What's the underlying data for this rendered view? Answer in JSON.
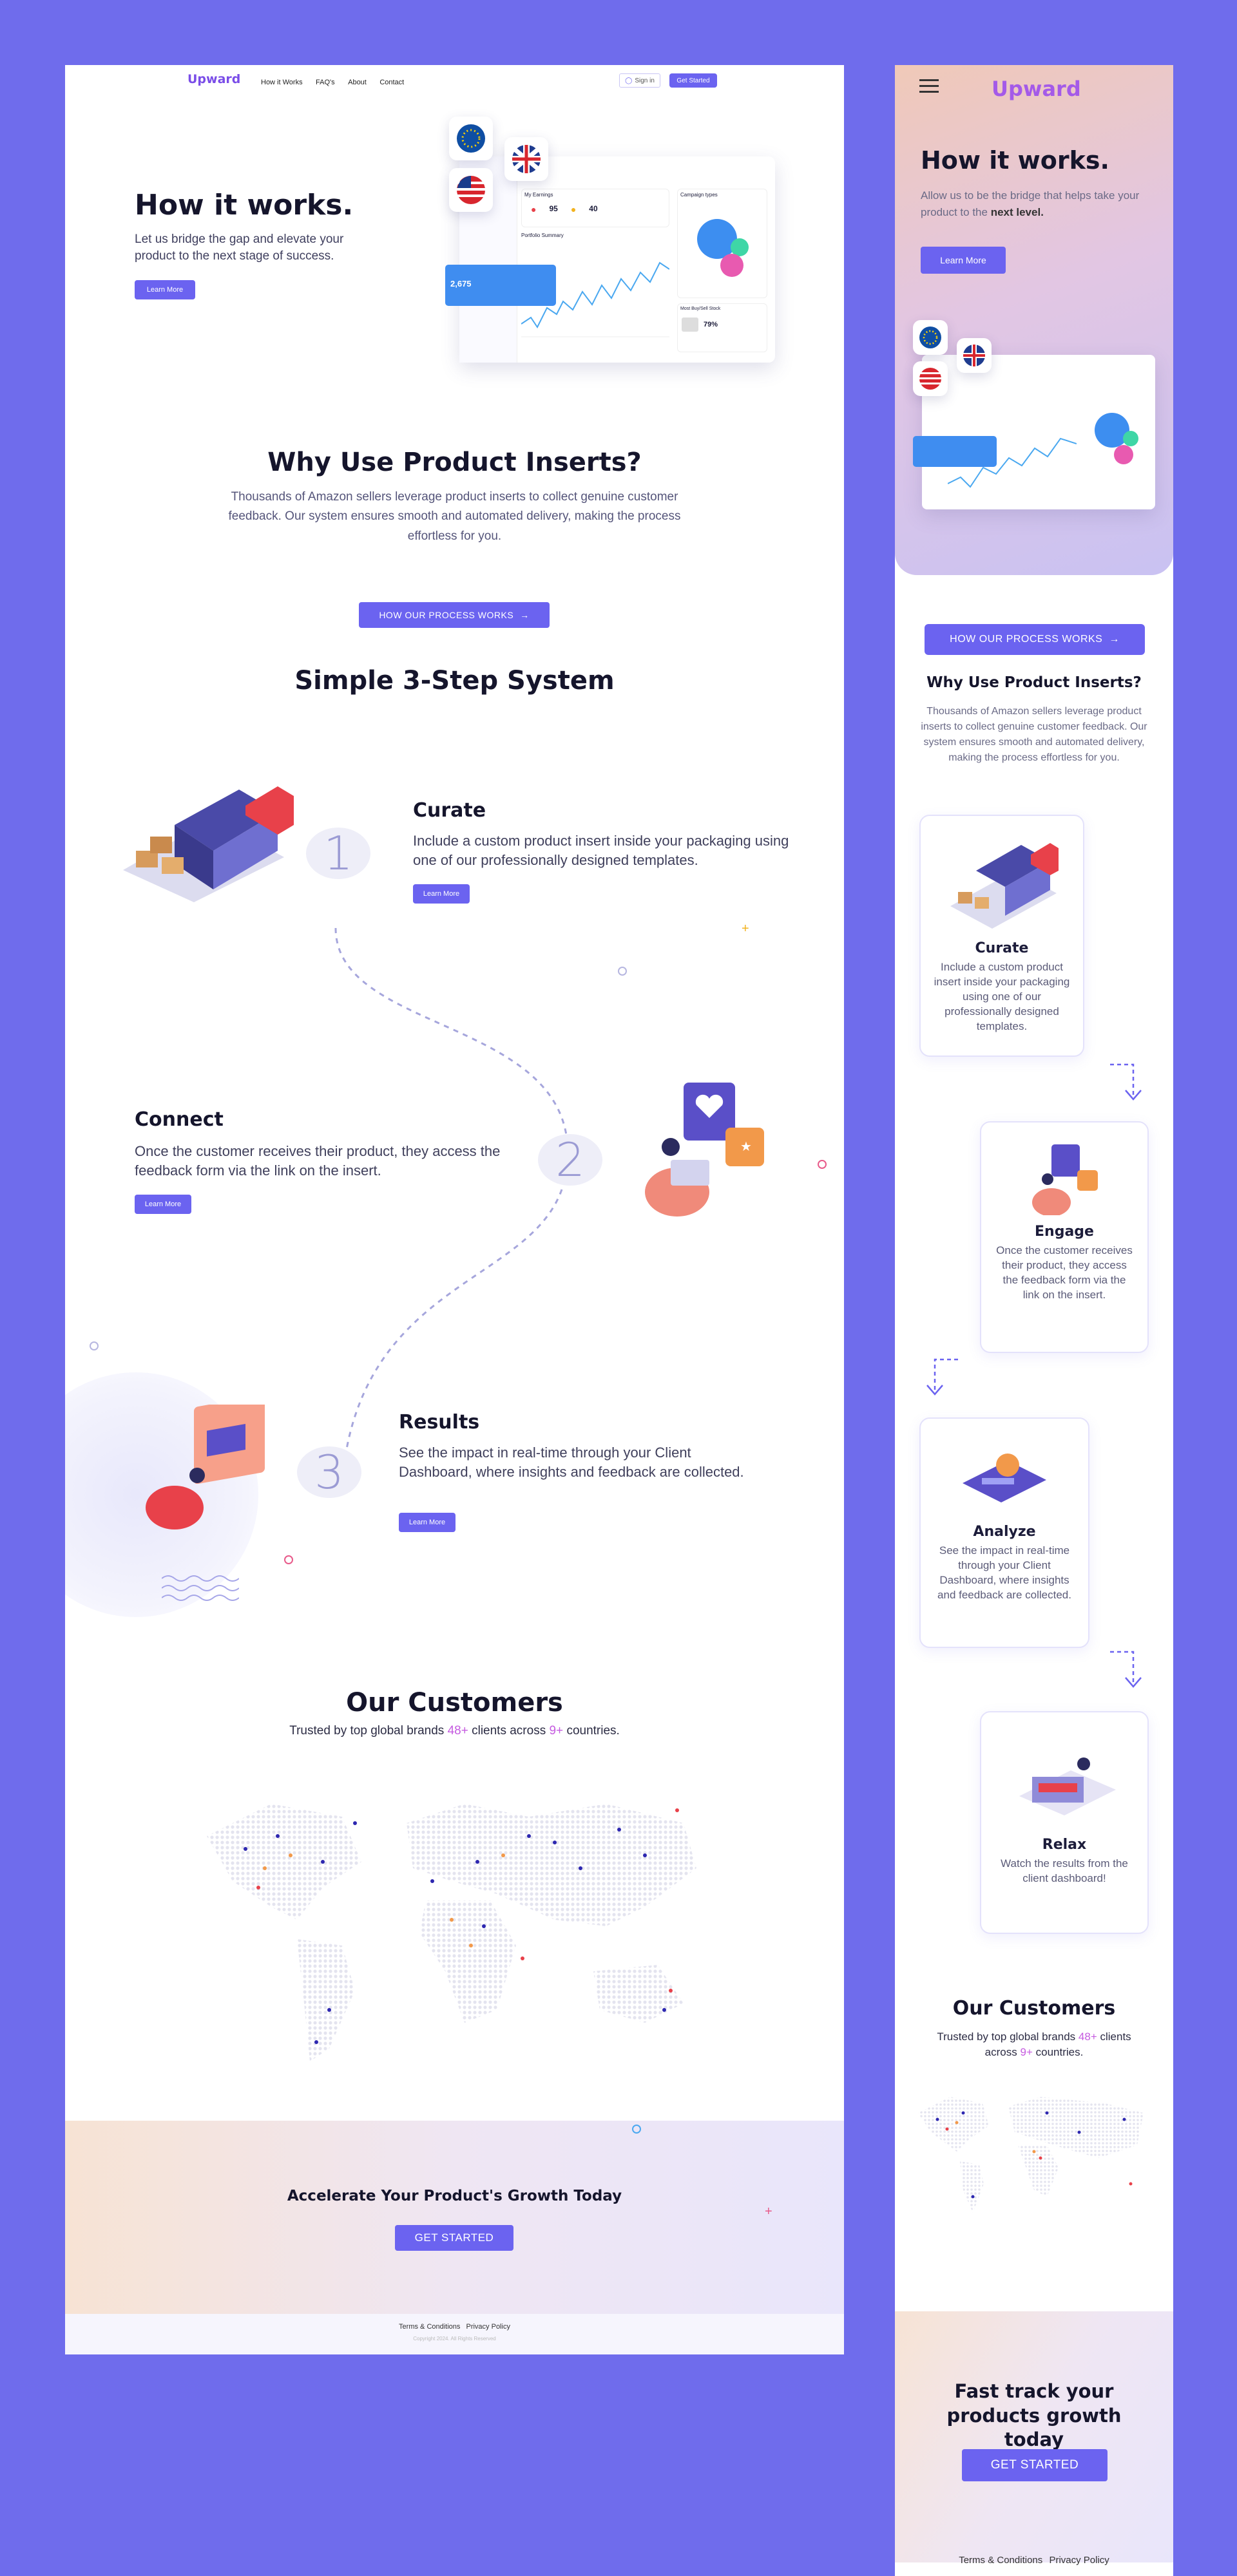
{
  "colors": {
    "accent": "#6b63f0",
    "background": "#6f6cec",
    "brand": "#7a4de8",
    "highlight": "#c55be0"
  },
  "desktop": {
    "nav": {
      "logo": "Upward",
      "links": [
        "How it Works",
        "FAQ's",
        "About",
        "Contact"
      ],
      "signin": "Sign in",
      "get_started": "Get Started"
    },
    "hero": {
      "title": "How it works.",
      "subtitle": "Let us bridge the gap and elevate your product to the next stage of success.",
      "cta": "Learn More"
    },
    "dashboard": {
      "card1": "My Earnings",
      "card1_val": "95",
      "card2_val": "40",
      "chart_title": "Portfolio Summary",
      "campaign": "Campaign types",
      "badge_val": "2,675",
      "pct1": "79%",
      "recent": "Most Buy/Sell Stock",
      "recent_val": "79%"
    },
    "why": {
      "title": "Why Use Product Inserts?",
      "text": "Thousands of Amazon sellers leverage product inserts to collect genuine customer feedback. Our system ensures smooth and automated delivery, making the process effortless for you.",
      "cta": "HOW OUR PROCESS WORKS"
    },
    "steps_title": "Simple 3-Step System",
    "steps": [
      {
        "num": "1",
        "title": "Curate",
        "text": "Include a custom product insert inside your packaging using one of our professionally designed templates.",
        "cta": "Learn More"
      },
      {
        "num": "2",
        "title": "Connect",
        "text": "Once the customer receives their product, they access the feedback form via the link on the insert.",
        "cta": "Learn More"
      },
      {
        "num": "3",
        "title": "Results",
        "text": "See the impact in real-time through your Client Dashboard, where insights and feedback are collected.",
        "cta": "Learn More"
      }
    ],
    "customers": {
      "title": "Our Customers",
      "pre": "Trusted by top global brands",
      "clients": "48+",
      "mid": "clients across",
      "countries": "9+",
      "post": "countries."
    },
    "cta": {
      "title": "Accelerate Your Product's Growth Today",
      "button": "GET STARTED"
    },
    "footer": {
      "links": [
        "Terms & Conditions",
        "Privacy Policy"
      ],
      "copyright": "Copyright 2024. All Rights Reserved"
    }
  },
  "mobile": {
    "logo": "Upward",
    "hero": {
      "title": "How it works.",
      "subtitle": "Allow us to be the bridge that helps take your product to the",
      "subtitle_bold": "next level.",
      "cta": "Learn More"
    },
    "process_cta": "HOW OUR PROCESS WORKS",
    "why": {
      "title": "Why Use Product Inserts?",
      "text": "Thousands of Amazon sellers leverage product inserts to collect genuine customer feedback. Our system ensures smooth and automated delivery, making the process effortless for you."
    },
    "cards": [
      {
        "title": "Curate",
        "text": "Include a custom product insert inside your packaging using one of our professionally designed templates."
      },
      {
        "title": "Engage",
        "text": "Once the customer receives their product, they access the feedback form via the link on the insert."
      },
      {
        "title": "Analyze",
        "text": "See the impact in real-time through your Client Dashboard, where insights and feedback are collected."
      },
      {
        "title": "Relax",
        "text": "Watch the results from the client dashboard!"
      }
    ],
    "customers": {
      "title": "Our Customers",
      "pre": "Trusted by top global brands",
      "clients": "48+",
      "mid": "clients across",
      "countries": "9+",
      "post": "countries."
    },
    "cta": {
      "title": "Fast track your products growth today",
      "button": "GET STARTED"
    },
    "footer": {
      "links": [
        "Terms & Conditions",
        "Privacy Policy"
      ]
    }
  }
}
